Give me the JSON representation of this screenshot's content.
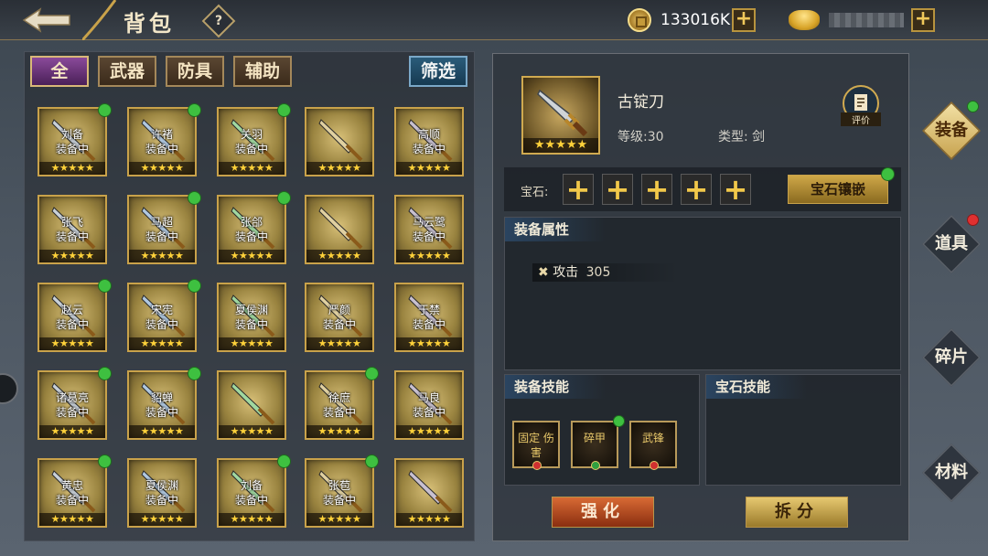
{
  "header": {
    "title": "背包",
    "help": "?",
    "currency": {
      "coins": "133016K"
    }
  },
  "inventory": {
    "tabs": [
      "全",
      "武器",
      "防具",
      "辅助"
    ],
    "active_tab": "全",
    "filter_label": "筛选",
    "status_text": "装备中",
    "stars": "★★★★★",
    "items": [
      {
        "owner": "刘备",
        "equipped": true,
        "new": true
      },
      {
        "owner": "许褚",
        "equipped": true,
        "new": true
      },
      {
        "owner": "关羽",
        "equipped": true,
        "new": true
      },
      {
        "owner": "",
        "equipped": false,
        "new": false
      },
      {
        "owner": "高顺",
        "equipped": true,
        "new": false
      },
      {
        "owner": "张飞",
        "equipped": true,
        "new": false
      },
      {
        "owner": "马超",
        "equipped": true,
        "new": true
      },
      {
        "owner": "张郃",
        "equipped": true,
        "new": true
      },
      {
        "owner": "",
        "equipped": false,
        "new": false
      },
      {
        "owner": "马云鹭",
        "equipped": true,
        "new": false
      },
      {
        "owner": "赵云",
        "equipped": true,
        "new": true
      },
      {
        "owner": "宋宪",
        "equipped": true,
        "new": true
      },
      {
        "owner": "夏侯渊",
        "equipped": true,
        "new": false
      },
      {
        "owner": "严颜",
        "equipped": true,
        "new": false
      },
      {
        "owner": "于禁",
        "equipped": true,
        "new": false
      },
      {
        "owner": "诸葛亮",
        "equipped": true,
        "new": true
      },
      {
        "owner": "貂蝉",
        "equipped": true,
        "new": true
      },
      {
        "owner": "",
        "equipped": false,
        "new": false
      },
      {
        "owner": "徐庶",
        "equipped": true,
        "new": true
      },
      {
        "owner": "马良",
        "equipped": true,
        "new": false
      },
      {
        "owner": "黄忠",
        "equipped": true,
        "new": true
      },
      {
        "owner": "夏侯渊",
        "equipped": true,
        "new": false
      },
      {
        "owner": "刘备",
        "equipped": true,
        "new": true
      },
      {
        "owner": "张苞",
        "equipped": true,
        "new": true
      },
      {
        "owner": "",
        "equipped": false,
        "new": false
      }
    ]
  },
  "detail": {
    "name": "古锭刀",
    "level": "等级:30",
    "type": "类型: 剑",
    "stars": "★★★★★",
    "review_label": "评价",
    "gem_label": "宝石:",
    "gem_slot": "+",
    "inlay_label": "宝石镶嵌",
    "attr_title": "装备属性",
    "attr_name": "攻击",
    "attr_value": "305",
    "skills_title": "装备技能",
    "skills": [
      "固定 伤害",
      "碎甲",
      "武锋"
    ],
    "gem_skills_title": "宝石技能",
    "strengthen_label": "强化",
    "split_label": "拆分"
  },
  "side_tabs": [
    {
      "label": "装备",
      "active": true,
      "badge": "green"
    },
    {
      "label": "道具",
      "active": false,
      "badge": "red"
    },
    {
      "label": "碎片",
      "active": false,
      "badge": ""
    },
    {
      "label": "材料",
      "active": false,
      "badge": ""
    }
  ],
  "colors": {
    "accent_gold": "#c9a24a",
    "badge_green": "#3ec040",
    "badge_red": "#e03030"
  }
}
